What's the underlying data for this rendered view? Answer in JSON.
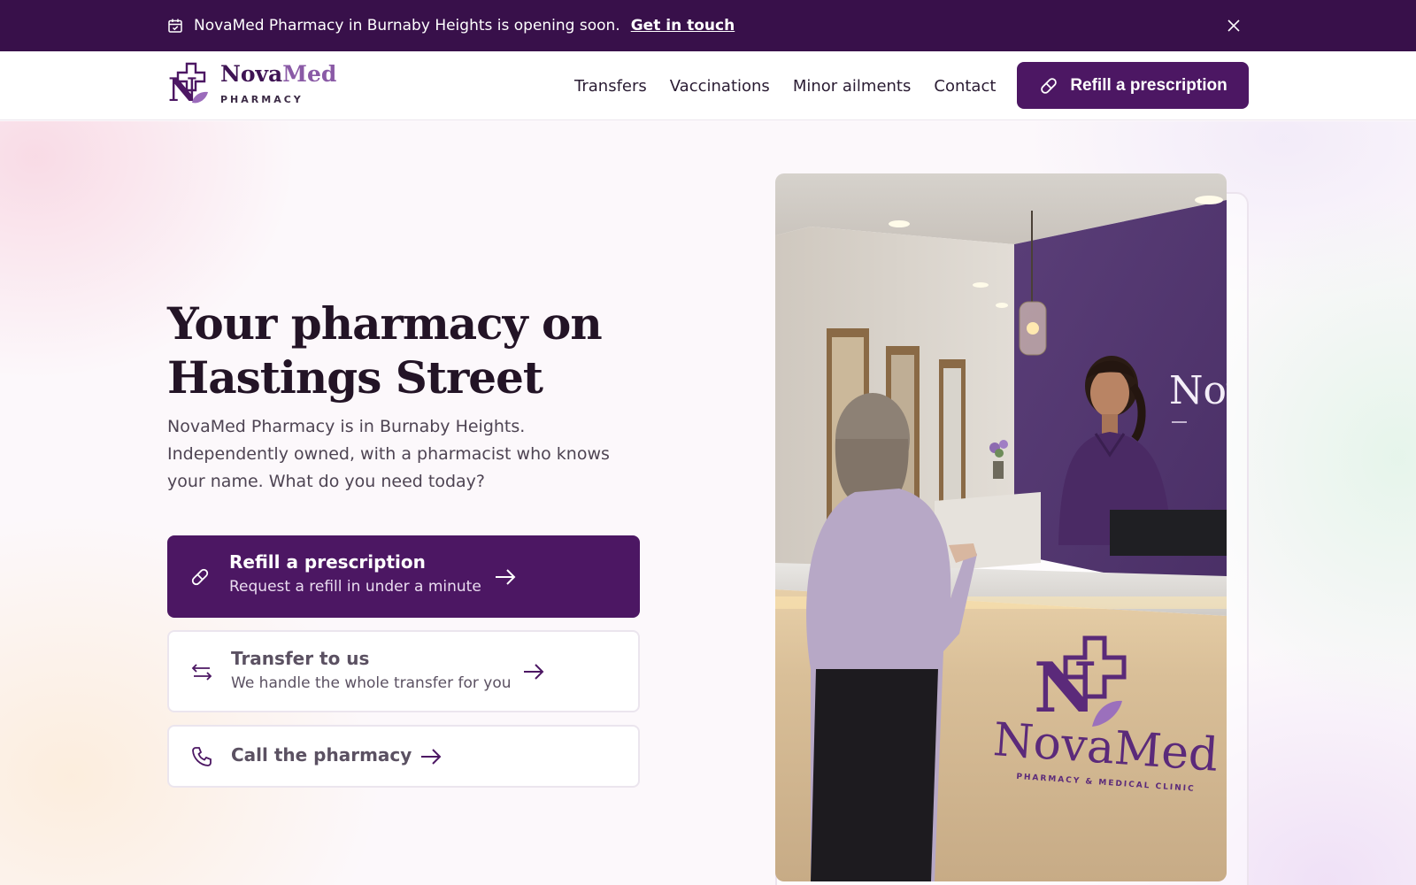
{
  "announcement": {
    "text": "NovaMed Pharmacy in Burnaby Heights is opening soon.",
    "link": "Get in touch"
  },
  "header": {
    "brand_first": "Nova",
    "brand_second": "Med",
    "brand_sub": "PHARMACY",
    "nav": [
      "Transfers",
      "Vaccinations",
      "Minor ailments",
      "Contact"
    ],
    "cta": "Refill a prescription"
  },
  "hero": {
    "title": "Your pharmacy on Hastings Street",
    "lead": "NovaMed Pharmacy is in Burnaby Heights. Independently owned, with a pharmacist who knows your name. What do you need today?",
    "actions": [
      {
        "title": "Refill a prescription",
        "subtitle": "Request a refill in under a minute",
        "icon": "pill-icon"
      },
      {
        "title": "Transfer to us",
        "subtitle": "We handle the whole transfer for you",
        "icon": "transfer-icon"
      },
      {
        "title": "Call the pharmacy",
        "icon": "phone-icon"
      }
    ]
  },
  "photo": {
    "sign_brand": "NovaMed",
    "sign_sub": "PHARMACY & MEDICAL CLINIC"
  },
  "colors": {
    "primary": "#4c1763",
    "announce_bg": "#38104a",
    "accent": "#8a5aa6"
  }
}
